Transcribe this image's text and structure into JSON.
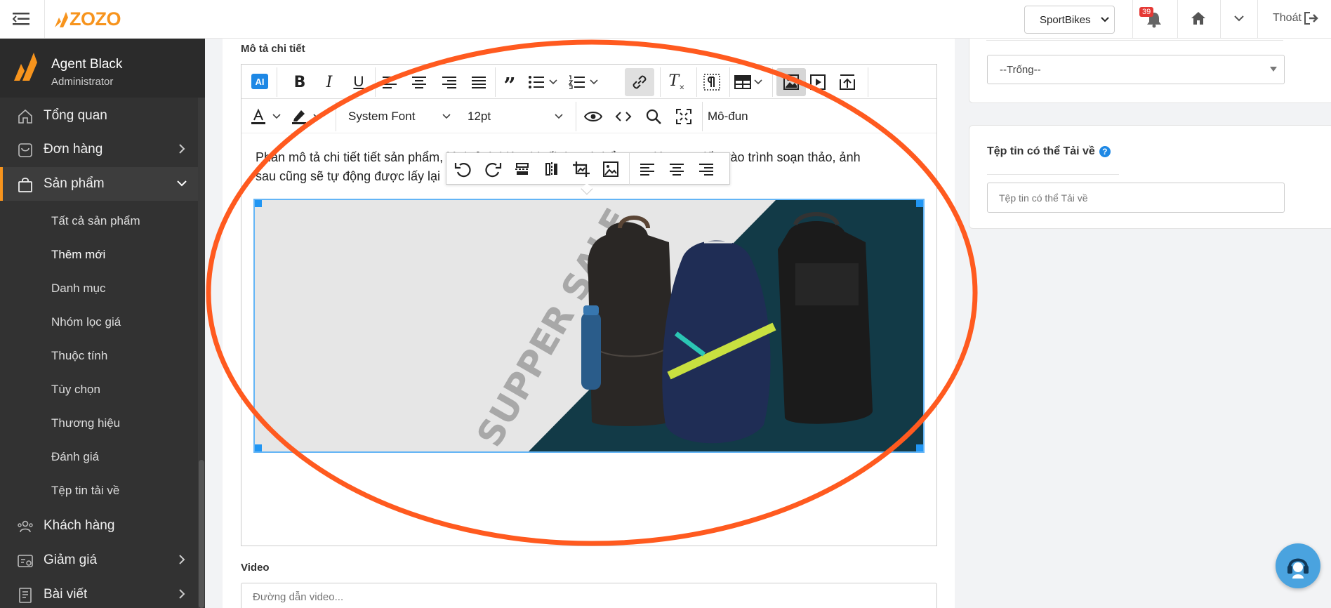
{
  "topbar": {
    "brand": "ZOZO",
    "store_select": "SportBikes",
    "notification_count": "39",
    "logout_label": "Thoát"
  },
  "sidebar": {
    "user_name": "Agent Black",
    "user_role": "Administrator",
    "items": [
      {
        "label": "Tổng quan",
        "icon": "home-icon"
      },
      {
        "label": "Đơn hàng",
        "icon": "orders-icon"
      },
      {
        "label": "Sản phẩm",
        "icon": "bag-icon",
        "active": true
      },
      {
        "label": "Khách hàng",
        "icon": "users-icon"
      },
      {
        "label": "Giảm giá",
        "icon": "discount-icon"
      },
      {
        "label": "Bài viết",
        "icon": "article-icon"
      }
    ],
    "sub_items": [
      "Tất cả sản phẩm",
      "Thêm mới",
      "Danh mục",
      "Nhóm lọc giá",
      "Thuộc tính",
      "Tùy chọn",
      "Thương hiệu",
      "Đánh giá",
      "Tệp tin tải về"
    ]
  },
  "editor": {
    "section_label": "Mô tả chi tiết",
    "ai_label": "AI",
    "font_family": "System Font",
    "font_size": "12pt",
    "module_label": "Mô-đun",
    "content_line1": "Phần mô tả chi tiết tiết sản phẩm, hình ảnh hiện thị tối đa, có thể copy dán trực tiếp vào trình soạn thảo, ảnh",
    "content_line2": "sau cũng sẽ tự động được lấy lại",
    "banner_text": "SUPPER SALE"
  },
  "video": {
    "label": "Video",
    "placeholder": "Đường dẫn video..."
  },
  "right": {
    "select_value": "--Trống--",
    "download_title": "Tệp tin có thể Tải về",
    "download_placeholder": "Tệp tin có thể Tải về"
  },
  "colors": {
    "brand_orange": "#f7941d",
    "sidebar_bg": "#323232",
    "accent_blue": "#1e88e5",
    "annotation_orange": "#ff5a1f"
  }
}
